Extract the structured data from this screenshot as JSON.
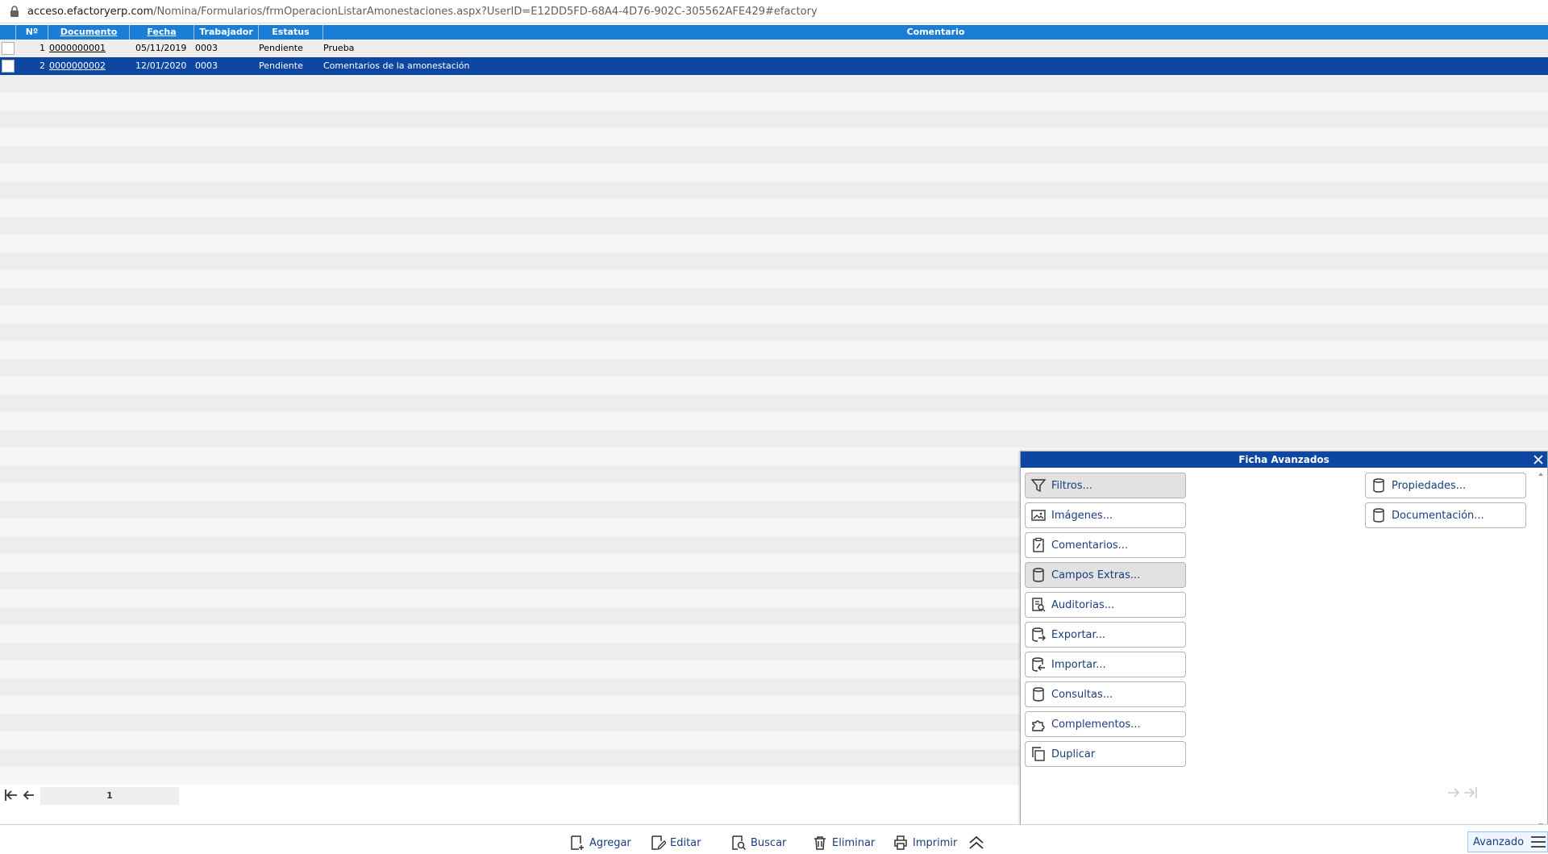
{
  "browser": {
    "url_host": "acceso.efactoryerp.com",
    "url_path": "/Nomina/Formularios/frmOperacionListarAmonestaciones.aspx?UserID=E12DD5FD-68A4-4D76-902C-305562AFE429#efactory"
  },
  "grid": {
    "headers": {
      "num": "Nº",
      "documento": "Documento",
      "fecha": "Fecha",
      "trabajador": "Trabajador",
      "estatus": "Estatus",
      "comentario": "Comentario"
    },
    "rows": [
      {
        "num": "1",
        "documento": "0000000001",
        "fecha": "05/11/2019",
        "trabajador": "0003",
        "estatus": "Pendiente",
        "comentario": "Prueba"
      },
      {
        "num": "2",
        "documento": "0000000002",
        "fecha": "12/01/2020",
        "trabajador": "0003",
        "estatus": "Pendiente",
        "comentario": "Comentarios de la amonestación"
      }
    ],
    "selected_row": 1,
    "colors": {
      "header": "#1b7ed6",
      "selected": "#0d47a1",
      "stripe_a": "#eeeeee",
      "stripe_b": "#f6f6f6"
    }
  },
  "pager": {
    "current_page": "1"
  },
  "toolbar": {
    "agregar": "Agregar",
    "editar": "Editar",
    "buscar": "Buscar",
    "eliminar": "Eliminar",
    "imprimir": "Imprimir",
    "avanzado": "Avanzado"
  },
  "panel": {
    "title": "Ficha Avanzados",
    "left_buttons": [
      {
        "label": "Filtros...",
        "icon": "filter-icon",
        "highlighted": true
      },
      {
        "label": "Imágenes...",
        "icon": "image-icon",
        "highlighted": false
      },
      {
        "label": "Comentarios...",
        "icon": "clipboard-icon",
        "highlighted": false
      },
      {
        "label": "Campos Extras...",
        "icon": "database-icon",
        "highlighted": true
      },
      {
        "label": "Auditorias...",
        "icon": "audit-icon",
        "highlighted": false
      },
      {
        "label": "Exportar...",
        "icon": "export-icon",
        "highlighted": false
      },
      {
        "label": "Importar...",
        "icon": "import-icon",
        "highlighted": false
      },
      {
        "label": "Consultas...",
        "icon": "database-icon",
        "highlighted": false
      },
      {
        "label": "Complementos...",
        "icon": "puzzle-icon",
        "highlighted": false
      },
      {
        "label": "Duplicar",
        "icon": "copy-icon",
        "highlighted": false
      }
    ],
    "right_buttons": [
      {
        "label": "Propiedades...",
        "icon": "database-icon"
      },
      {
        "label": "Documentación...",
        "icon": "database-icon"
      }
    ]
  }
}
